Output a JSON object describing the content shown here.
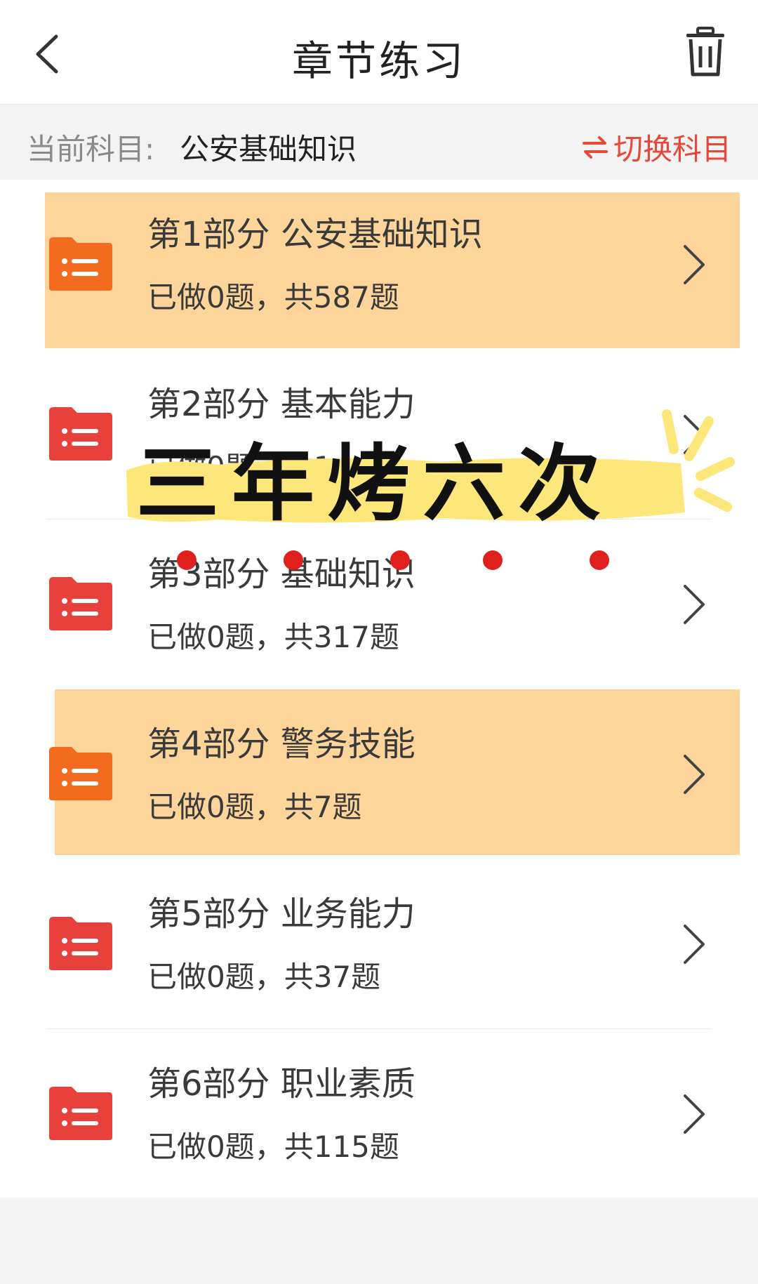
{
  "header": {
    "title": "章节练习",
    "back_icon": "chevron-left-icon",
    "trash_icon": "trash-icon"
  },
  "subject": {
    "label": "当前科目:",
    "name": "公安基础知识",
    "switch_label": "切换科目",
    "switch_icon": "swap-arrows-icon"
  },
  "colors": {
    "accent": "#e8483a",
    "highlight": "#fdd59a",
    "folder_red": "#e8413c",
    "folder_orange": "#f26b1f"
  },
  "chapters": [
    {
      "title": "第1部分 公安基础知识",
      "count": "已做0题，共587题",
      "highlighted": true
    },
    {
      "title": "第2部分 基本能力",
      "count": "已做0题，共1…题",
      "highlighted": false
    },
    {
      "title": "第3部分 基础知识",
      "count": "已做0题，共317题",
      "highlighted": false
    },
    {
      "title": "第4部分 警务技能",
      "count": "已做0题，共7题",
      "highlighted": true
    },
    {
      "title": "第5部分 业务能力",
      "count": "已做0题，共37题",
      "highlighted": false
    },
    {
      "title": "第6部分 职业素质",
      "count": "已做0题，共115题",
      "highlighted": false
    }
  ],
  "sticker": {
    "text": "三年烤六次"
  }
}
